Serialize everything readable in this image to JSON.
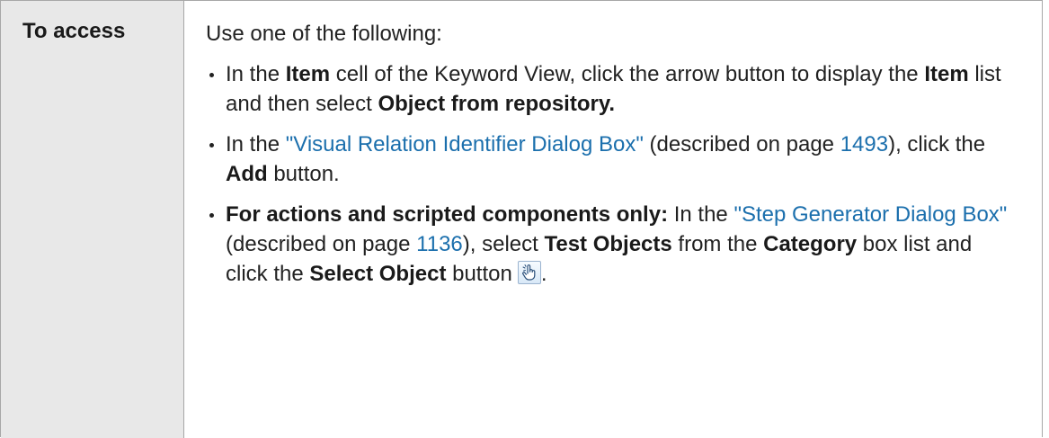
{
  "row": {
    "label": "To access",
    "intro": "Use one of the following:",
    "items": [
      {
        "p1": "In the ",
        "b1": "Item",
        "p2": " cell of the Keyword View, click the arrow button to display the ",
        "b2": "Item",
        "p3": " list and then select ",
        "b3": "Object from repository."
      },
      {
        "p1": "In the ",
        "link1": "\"Visual Relation Identifier Dialog Box\"",
        "p2": " (described on page ",
        "link2": "1493",
        "p3": "), click the ",
        "b1": "Add",
        "p4": " button."
      },
      {
        "b1": "For actions and scripted components only:",
        "p1": " In the ",
        "link1": "\"Step Generator Dialog Box\"",
        "p2": " (described on page ",
        "link2": "1136",
        "p3": "), select ",
        "b2": "Test Objects",
        "p4": " from the ",
        "b3": "Category",
        "p5": " box list and click the ",
        "b4": "Select Object",
        "p6": " button",
        "p7": ".",
        "icon": "pointing-hand-icon"
      }
    ]
  }
}
